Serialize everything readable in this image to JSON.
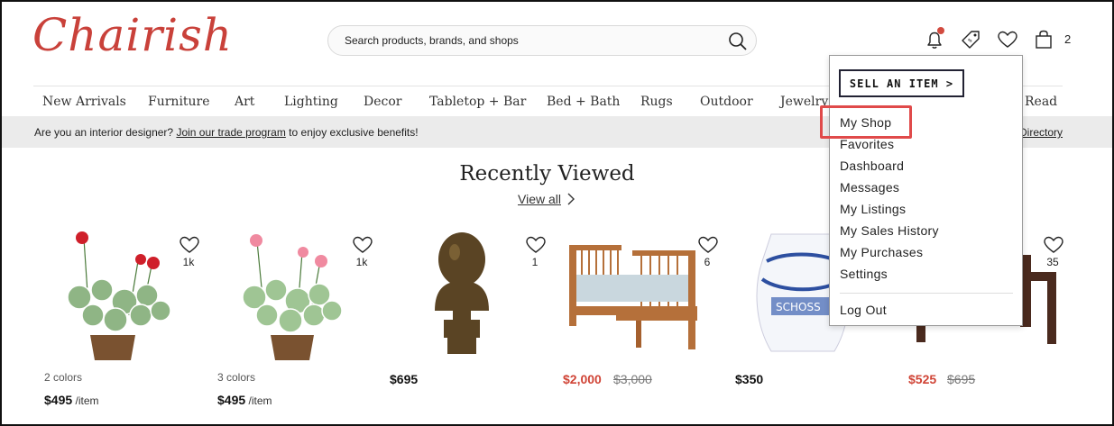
{
  "header": {
    "logo_text": "Chairish",
    "search_placeholder": "Search products, brands, and shops",
    "cart_count": "2"
  },
  "nav": {
    "items": [
      "New Arrivals",
      "Furniture",
      "Art",
      "Lighting",
      "Decor",
      "Tabletop + Bar",
      "Bed + Bath",
      "Rugs",
      "Outdoor",
      "Jewelry",
      "Read"
    ]
  },
  "banner": {
    "prefix": "Are you an interior designer? ",
    "link": "Join our trade program",
    "suffix": " to enjoy exclusive benefits!",
    "right_link": "Directory"
  },
  "recently_viewed": {
    "title": "Recently Viewed",
    "view_all": "View all",
    "products": [
      {
        "likes": "1k",
        "variant": "2 colors",
        "price": "$495",
        "per": " /item"
      },
      {
        "likes": "1k",
        "variant": "3 colors",
        "price": "$495",
        "per": " /item"
      },
      {
        "likes": "1",
        "price": "$695"
      },
      {
        "likes": "6",
        "price": "$2,000",
        "original_price": "$3,000"
      },
      {
        "price": "$350"
      },
      {
        "likes": "35",
        "price": "$525",
        "original_price": "$695"
      }
    ]
  },
  "dropdown": {
    "sell_button": "SELL AN ITEM >",
    "items": [
      "My Shop",
      "Favorites",
      "Dashboard",
      "Messages",
      "My Listings",
      "My Sales History",
      "My Purchases",
      "Settings"
    ],
    "logout": "Log Out"
  },
  "colors": {
    "brand": "#c9413a",
    "sale": "#d04436",
    "highlight": "#e04a4a"
  }
}
